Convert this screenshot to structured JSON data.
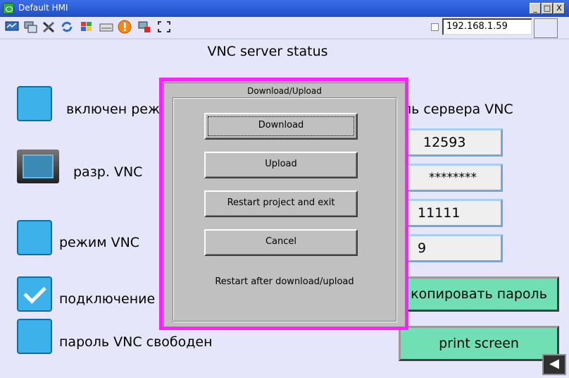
{
  "window": {
    "title": "Default HMI"
  },
  "window_buttons": {
    "minimize": "_",
    "maximize": "□",
    "close": "X"
  },
  "toolbar": {
    "icons": [
      "monitor-icon",
      "windows-icon",
      "tools-icon",
      "refresh-icon",
      "flag-icon",
      "keyboard-icon",
      "alert-icon",
      "network-icon",
      "fullscreen-icon"
    ],
    "ip_address": "192.168.1.59"
  },
  "main": {
    "heading": "VNC server status",
    "checkbox_labels": {
      "mode_enabled": "включен режим",
      "vnc_allowed": "разр. VNC",
      "vnc_mode": "режим VNC",
      "vnc_connection": "подключение V",
      "vnc_password_free": "пароль VNC свободен"
    },
    "password_label": "ль сервера VNC",
    "fields": {
      "port": "12593",
      "password": "********",
      "value3": "11111",
      "value4": "9"
    },
    "buttons": {
      "copy_password": "копировать пароль",
      "print_screen": "print screen"
    }
  },
  "dialog": {
    "title": "Download/Upload",
    "buttons": {
      "download": "Download",
      "upload": "Upload",
      "restart": "Restart project and exit",
      "cancel": "Cancel"
    },
    "note": "Restart after download/upload"
  },
  "colors": {
    "accent": "#3db2ea",
    "dialog_border": "#ff20ff",
    "button_green": "#70e0b4"
  }
}
